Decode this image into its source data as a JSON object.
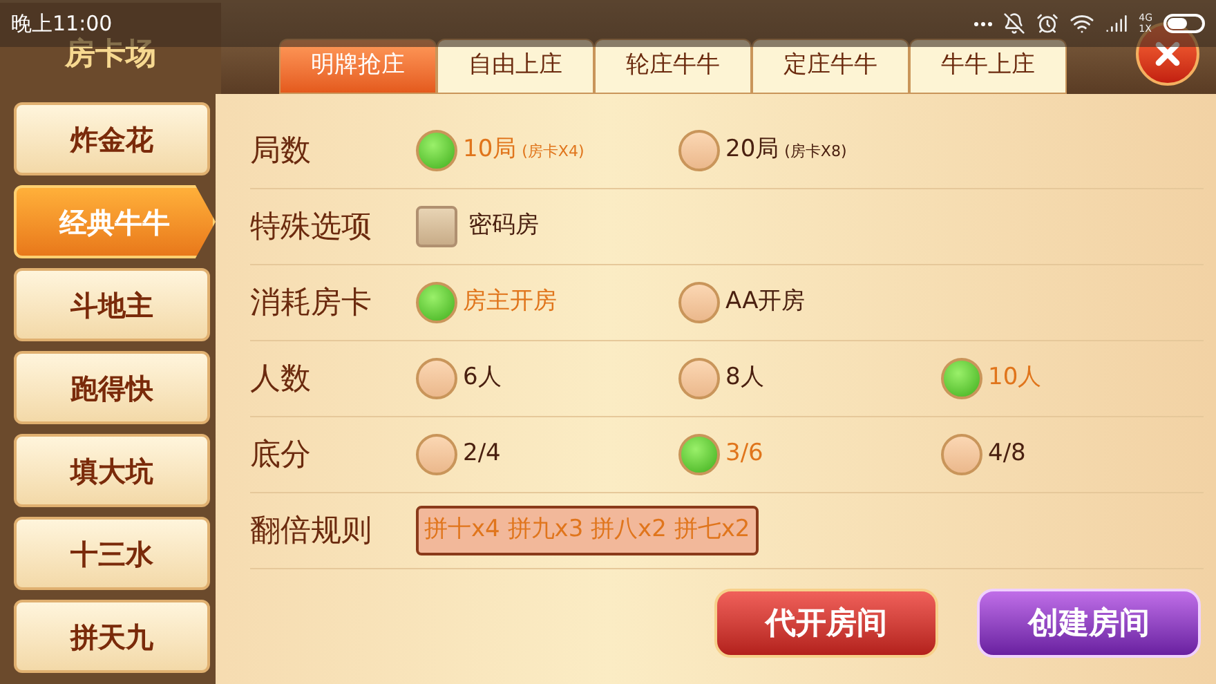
{
  "status_bar": {
    "time": "晚上11:00",
    "network": "4G\n1X"
  },
  "header": {
    "title": "房卡场"
  },
  "tabs": [
    {
      "label": "明牌抢庄",
      "selected": true
    },
    {
      "label": "自由上庄",
      "selected": false
    },
    {
      "label": "轮庄牛牛",
      "selected": false
    },
    {
      "label": "定庄牛牛",
      "selected": false
    },
    {
      "label": "牛牛上庄",
      "selected": false
    }
  ],
  "sidebar": {
    "items": [
      {
        "label": "炸金花",
        "selected": false
      },
      {
        "label": "经典牛牛",
        "selected": true
      },
      {
        "label": "斗地主",
        "selected": false
      },
      {
        "label": "跑得快",
        "selected": false
      },
      {
        "label": "填大坑",
        "selected": false
      },
      {
        "label": "十三水",
        "selected": false
      },
      {
        "label": "拼天九",
        "selected": false
      }
    ]
  },
  "settings": [
    {
      "label": "局数",
      "kind": "radio",
      "options": [
        {
          "label": "10局",
          "note": "(房卡X4)",
          "selected": true
        },
        {
          "label": "20局",
          "note": "(房卡X8)",
          "selected": false
        }
      ]
    },
    {
      "label": "特殊选项",
      "kind": "checkbox",
      "options": [
        {
          "label": "密码房",
          "checked": false
        }
      ]
    },
    {
      "label": "消耗房卡",
      "kind": "radio",
      "options": [
        {
          "label": "房主开房",
          "selected": true
        },
        {
          "label": "AA开房",
          "selected": false
        }
      ]
    },
    {
      "label": "人数",
      "kind": "radio",
      "options": [
        {
          "label": "6人",
          "selected": false
        },
        {
          "label": "8人",
          "selected": false
        },
        {
          "label": "10人",
          "selected": true
        }
      ]
    },
    {
      "label": "底分",
      "kind": "radio",
      "options": [
        {
          "label": "2/4",
          "selected": false
        },
        {
          "label": "3/6",
          "selected": true
        },
        {
          "label": "4/8",
          "selected": false
        }
      ]
    },
    {
      "label": "翻倍规则",
      "kind": "text",
      "value": "拼十x4 拼九x3 拼八x2 拼七x2"
    }
  ],
  "buttons": [
    {
      "label": "代开房间",
      "kind": "red"
    },
    {
      "label": "创建房间",
      "kind": "purple"
    }
  ]
}
